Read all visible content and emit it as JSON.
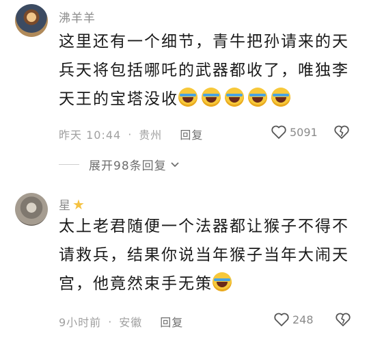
{
  "comments": [
    {
      "username": "沸羊羊",
      "text": "这里还有一个细节，青牛把孙请来的天兵天将包括哪吒的武器都收了，唯独李天王的宝塔没收",
      "emoji_count": 5,
      "time": "昨天 10:44",
      "location": "贵州",
      "reply_label": "回复",
      "likes": "5091",
      "expand_label": "展开98条回复"
    },
    {
      "username": "星",
      "text": "太上老君随便一个法器都让猴子不得不请救兵，结果你说当年猴子当年大闹天宫，他竟然束手无策",
      "emoji_count": 1,
      "time": "9小时前",
      "location": "安徽",
      "reply_label": "回复",
      "likes": "248"
    }
  ],
  "colors": {
    "name": "#8a8a8a",
    "meta": "#a0a0a0",
    "star": "#f5c242",
    "emoji": "#f7c83a"
  },
  "icons": [
    "heart-icon",
    "broken-heart-icon",
    "chevron-down-icon",
    "star-icon",
    "laughing-crying-emoji"
  ]
}
